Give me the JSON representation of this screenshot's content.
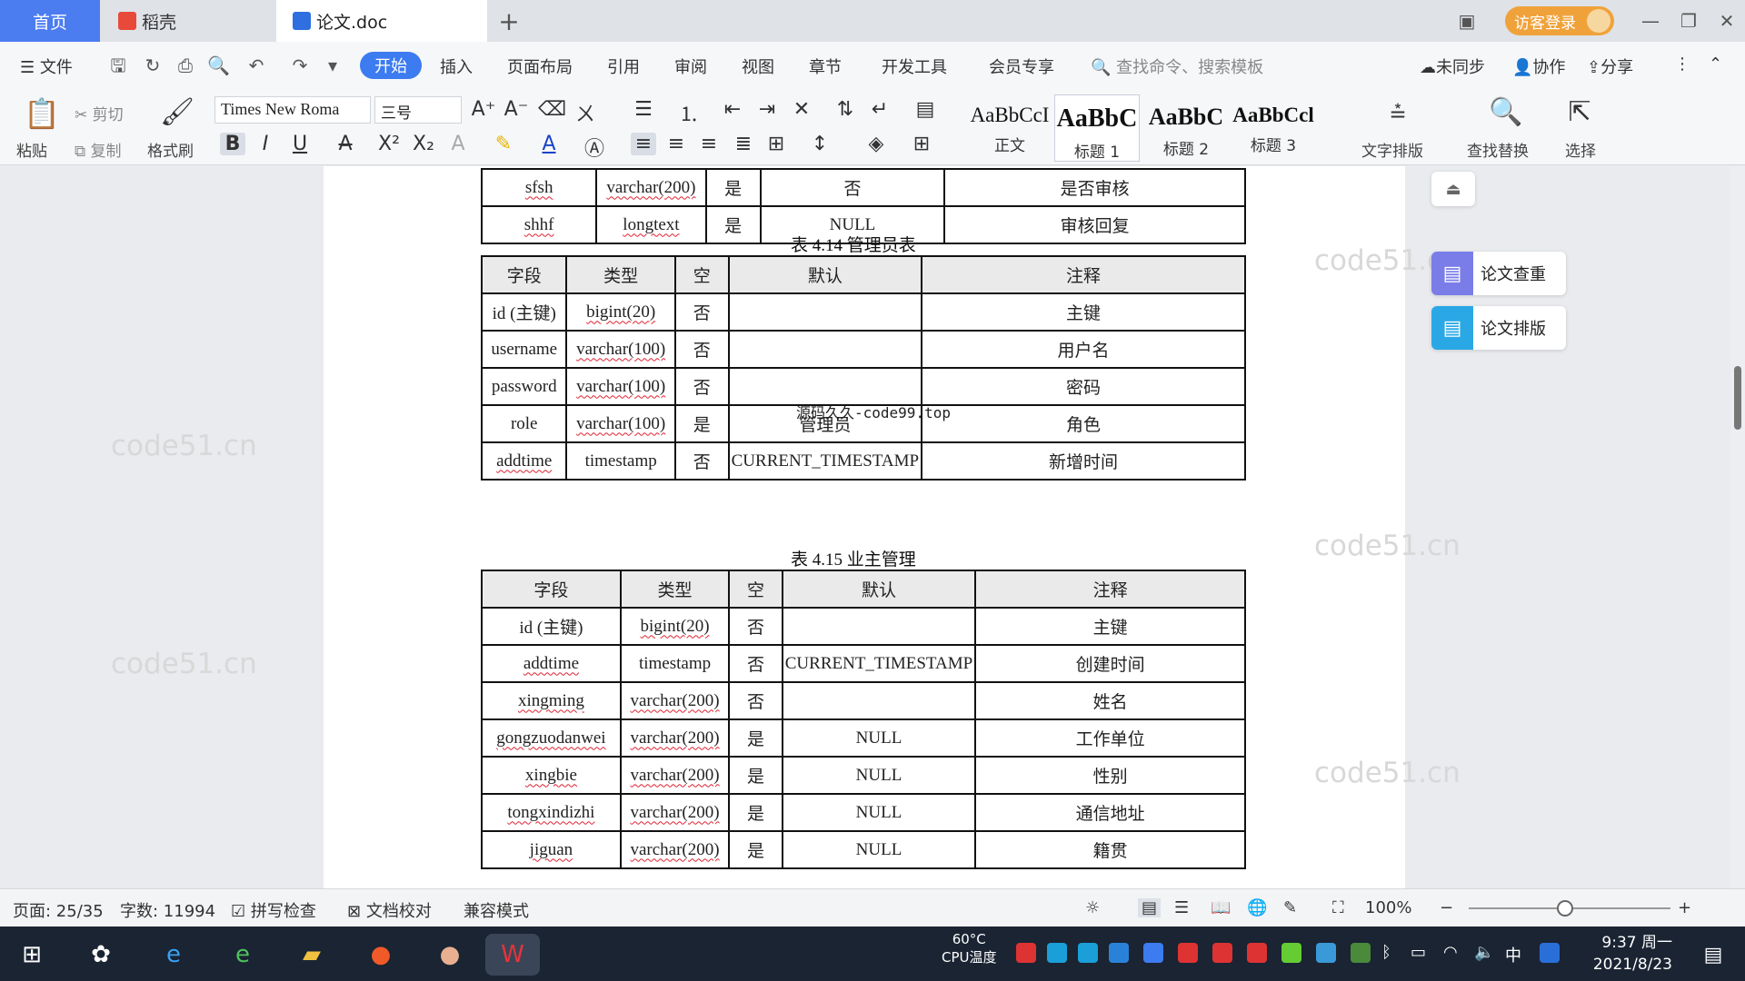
{
  "tabs": {
    "home": "首页",
    "daoke": "稻壳",
    "doc": "论文.doc",
    "add": "+"
  },
  "topright": {
    "login": "访客登录"
  },
  "menu": {
    "file": "文件",
    "items": [
      "开始",
      "插入",
      "页面布局",
      "引用",
      "审阅",
      "视图",
      "章节",
      "开发工具",
      "会员专享"
    ],
    "search": "查找命令、搜索模板",
    "sync": "未同步",
    "collab": "协作",
    "share": "分享"
  },
  "ribbon": {
    "paste": "粘贴",
    "cut": "剪切",
    "copy": "复制",
    "format_painter": "格式刷",
    "font": "Times New Roma",
    "size": "三号",
    "text_layout": "文字排版",
    "find_replace": "查找替换",
    "select": "选择"
  },
  "styles": [
    {
      "preview": "AaBbCcI",
      "name": "正文"
    },
    {
      "preview": "AaBbC",
      "name": "标题 1"
    },
    {
      "preview": "AaBbC",
      "name": "标题 2"
    },
    {
      "preview": "AaBbCcl",
      "name": "标题 3"
    }
  ],
  "side": {
    "check": "论文查重",
    "layout": "论文排版"
  },
  "watermark": "code51.cn",
  "overlay": "源码久久-code99.top",
  "table_top": {
    "rows": [
      [
        "sfsh",
        "varchar(200)",
        "是",
        "否",
        "是否审核"
      ],
      [
        "shhf",
        "longtext",
        "是",
        "NULL",
        "审核回复"
      ]
    ]
  },
  "table_admin": {
    "caption": "表 4.14  管理员表",
    "header": [
      "字段",
      "类型",
      "空",
      "默认",
      "注释"
    ],
    "rows": [
      [
        "id (主键)",
        "bigint(20)",
        "否",
        "",
        "主键"
      ],
      [
        "username",
        "varchar(100)",
        "否",
        "",
        "用户名"
      ],
      [
        "password",
        "varchar(100)",
        "否",
        "",
        "密码"
      ],
      [
        "role",
        "varchar(100)",
        "是",
        "管理员",
        "角色"
      ],
      [
        "addtime",
        "timestamp",
        "否",
        "CURRENT_TIMESTAMP",
        "新增时间"
      ]
    ]
  },
  "table_owner": {
    "caption": "表 4.15  业主管理",
    "header": [
      "字段",
      "类型",
      "空",
      "默认",
      "注释"
    ],
    "rows": [
      [
        "id (主键)",
        "bigint(20)",
        "否",
        "",
        "主键"
      ],
      [
        "addtime",
        "timestamp",
        "否",
        "CURRENT_TIMESTAMP",
        "创建时间"
      ],
      [
        "xingming",
        "varchar(200)",
        "否",
        "",
        "姓名"
      ],
      [
        "gongzuodanwei",
        "varchar(200)",
        "是",
        "NULL",
        "工作单位"
      ],
      [
        "xingbie",
        "varchar(200)",
        "是",
        "NULL",
        "性别"
      ],
      [
        "tongxindizhi",
        "varchar(200)",
        "是",
        "NULL",
        "通信地址"
      ],
      [
        "jiguan",
        "varchar(200)",
        "是",
        "NULL",
        "籍贯"
      ]
    ]
  },
  "status": {
    "page": "页面: 25/35",
    "words": "字数: 11994",
    "spell": "拼写检查",
    "proof": "文档校对",
    "compat": "兼容模式",
    "zoom": "100%",
    "zoom_level": 100
  },
  "taskbar": {
    "temp": "60°C",
    "cpu": "CPU温度",
    "time": "9:37 周一",
    "date": "2021/8/23",
    "ime": "中"
  }
}
